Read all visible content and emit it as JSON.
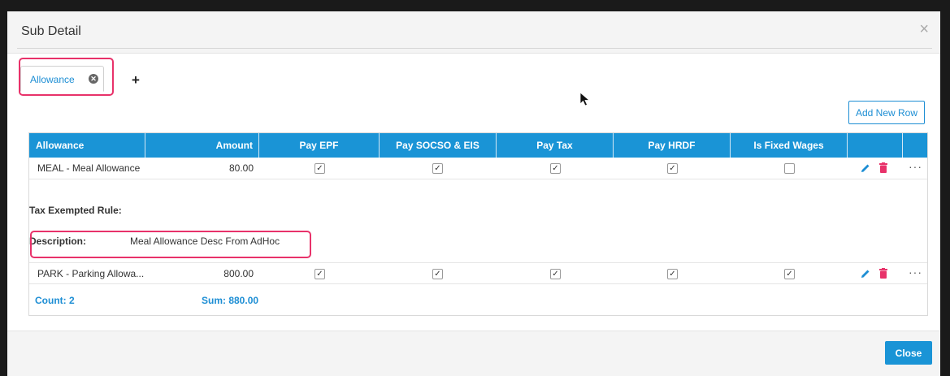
{
  "modal": {
    "title": "Sub Detail",
    "close_icon": "×"
  },
  "tabs": [
    {
      "label": "Allowance"
    }
  ],
  "add_tab_label": "+",
  "add_row_label": "Add New Row",
  "grid": {
    "columns": [
      "Allowance",
      "Amount",
      "Pay EPF",
      "Pay SOCSO & EIS",
      "Pay Tax",
      "Pay HRDF",
      "Is Fixed Wages"
    ],
    "rows": [
      {
        "allowance": "MEAL - Meal Allowance",
        "amount": "80.00",
        "pay_epf": true,
        "pay_socso": true,
        "pay_tax": true,
        "pay_hrdf": true,
        "fixed_wages": false
      },
      {
        "allowance": "PARK - Parking Allowa...",
        "amount": "800.00",
        "pay_epf": true,
        "pay_socso": true,
        "pay_tax": true,
        "pay_hrdf": true,
        "fixed_wages": true
      }
    ],
    "detail": {
      "tax_label": "Tax Exempted Rule:",
      "desc_label": "Description:",
      "desc_value": "Meal Allowance Desc From AdHoc"
    },
    "footer": {
      "count": "Count: 2",
      "sum": "Sum: 880.00"
    },
    "row_actions": {
      "more_label": "···"
    }
  },
  "footer": {
    "close_label": "Close"
  },
  "colors": {
    "accent": "#1a94d6",
    "highlight": "#e8326a",
    "delete": "#e8326a"
  }
}
